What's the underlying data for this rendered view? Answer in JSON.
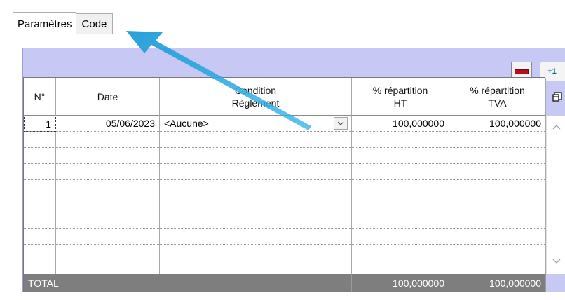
{
  "tabs": [
    {
      "label": "Paramètres",
      "active": true
    },
    {
      "label": "Code",
      "active": false
    }
  ],
  "toolbar": {
    "remove_icon": "minus-icon",
    "add_icon_text": "+1"
  },
  "table": {
    "columns": [
      {
        "line1": "N°",
        "line2": ""
      },
      {
        "line1": "Date",
        "line2": ""
      },
      {
        "line1": "Condition",
        "line2": "Règlement"
      },
      {
        "line1": "% répartition",
        "line2": "HT"
      },
      {
        "line1": "% répartition",
        "line2": "TVA"
      }
    ],
    "rows": [
      {
        "num": "1",
        "date": "05/06/2023",
        "condition": "<Aucune>",
        "ht": "100,000000",
        "tva": "100,000000"
      }
    ],
    "total": {
      "label": "TOTAL",
      "ht": "100,000000",
      "tva": "100,000000"
    }
  },
  "colors": {
    "frame": "#c8c8f4",
    "total_bar": "#7e7e7e",
    "arrow": "#29a8e0",
    "remove": "#b3121c"
  }
}
